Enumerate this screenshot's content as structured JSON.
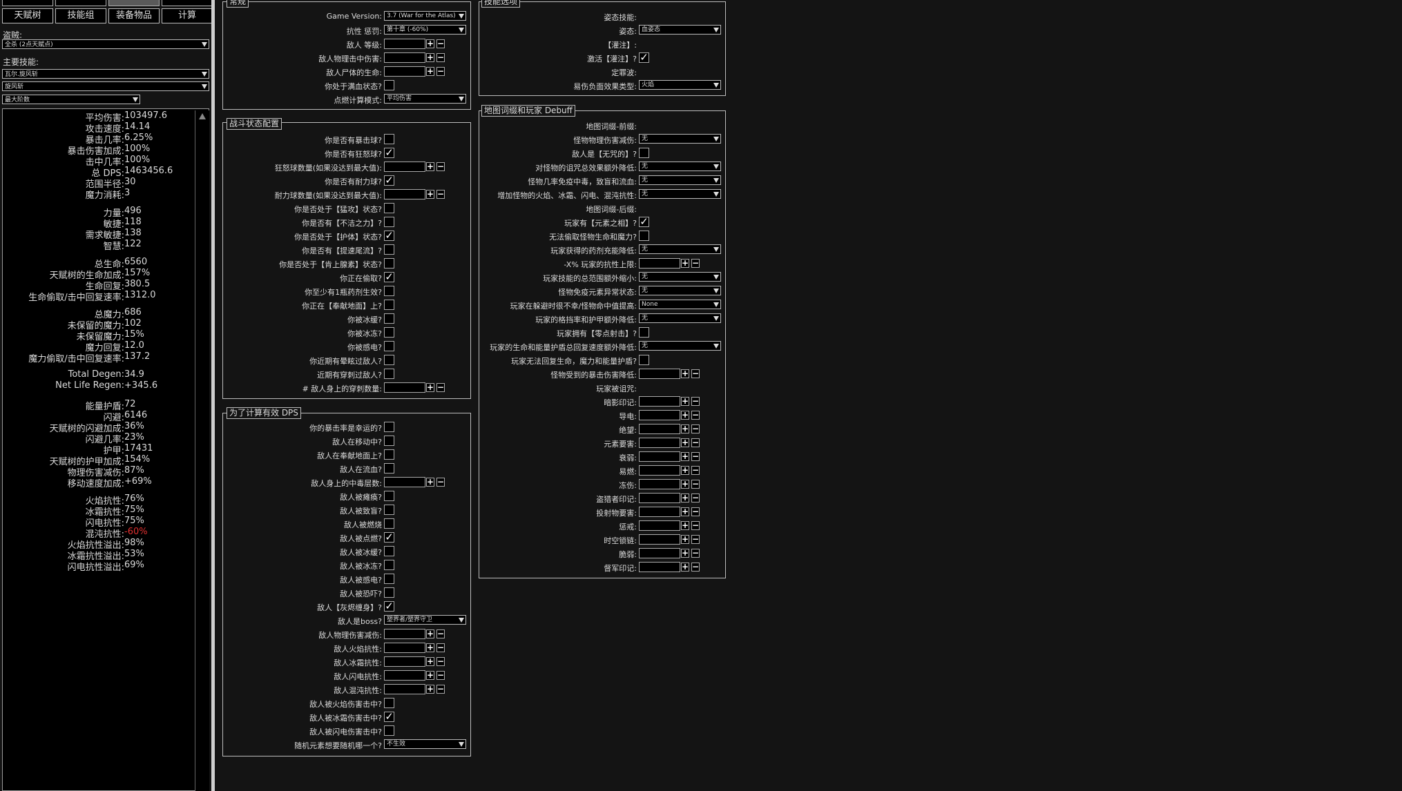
{
  "colors": {
    "background": "#141414",
    "negative": "#e03030",
    "border": "#bdbdbd"
  },
  "nav": {
    "tab_talent": "天赋树",
    "tab_gems": "技能组",
    "tab_items": "装备物品",
    "tab_calc": "计算"
  },
  "left": {
    "bandit_label": "盗贼:",
    "bandit_value": "全杀 (2点天赋点)",
    "main_skill_label": "主要技能:",
    "main_skill_value": "瓦尔.旋风斩",
    "sub_skill_value": "旋风斩",
    "stage_value": "最大阶数"
  },
  "stats": {
    "s1": [
      [
        "平均伤害:",
        "103497.6"
      ],
      [
        "攻击速度:",
        "14.14"
      ],
      [
        "暴击几率:",
        "6.25%"
      ],
      [
        "暴击伤害加成:",
        "100%"
      ],
      [
        "击中几率:",
        "100%"
      ],
      [
        "总 DPS:",
        "1463456.6"
      ],
      [
        "范围半径:",
        "30"
      ],
      [
        "魔力消耗:",
        "3"
      ]
    ],
    "s2": [
      [
        "力量:",
        "496"
      ],
      [
        "敏捷:",
        "118"
      ],
      [
        "需求敏捷:",
        "138"
      ],
      [
        "智慧:",
        "122"
      ]
    ],
    "s3": [
      [
        "总生命:",
        "6560"
      ],
      [
        "天赋树的生命加成:",
        "157%"
      ],
      [
        "生命回复:",
        "380.5"
      ],
      [
        "生命偷取/击中回复速率:",
        "1312.0"
      ]
    ],
    "s4": [
      [
        "总魔力:",
        "686"
      ],
      [
        "未保留的魔力:",
        "102"
      ],
      [
        "未保留魔力:",
        "15%"
      ],
      [
        "魔力回复:",
        "12.0"
      ],
      [
        "魔力偷取/击中回复速率:",
        "137.2"
      ]
    ],
    "s5": [
      [
        "Total Degen:",
        "34.9"
      ],
      [
        "Net Life Regen:",
        "+345.6"
      ]
    ],
    "s6": [
      [
        "能量护盾:",
        "72"
      ],
      [
        "闪避:",
        "6146"
      ],
      [
        "天赋树的闪避加成:",
        "36%"
      ],
      [
        "闪避几率:",
        "23%"
      ],
      [
        "护甲:",
        "17431"
      ],
      [
        "天赋树的护甲加成:",
        "154%"
      ],
      [
        "物理伤害减伤:",
        "87%"
      ],
      [
        "移动速度加成:",
        "+69%"
      ]
    ],
    "s7": [
      [
        "火焰抗性:",
        "76%"
      ],
      [
        "冰霜抗性:",
        "75%"
      ],
      [
        "闪电抗性:",
        "75%"
      ],
      [
        "混沌抗性:",
        "-60%"
      ],
      [
        "火焰抗性溢出:",
        "98%"
      ],
      [
        "冰霜抗性溢出:",
        "53%"
      ],
      [
        "闪电抗性溢出:",
        "69%"
      ]
    ]
  },
  "general": {
    "title": "常规",
    "game_version_label": "Game Version:",
    "game_version_value": "3.7 (War for the Atlas)",
    "res_penalty_label": "抗性 惩罚:",
    "res_penalty_value": "第十章 (-60%)",
    "enemy_level_label": "敌人 等级:",
    "enemy_phys_label": "敌人物理击中伤害:",
    "corpse_life_label": "敌人尸体的生命:",
    "full_life_label": "你处于满血状态?",
    "ignite_mode_label": "点燃计算模式:",
    "ignite_mode_value": "平均伤害"
  },
  "combat": {
    "title": "战斗状态配置",
    "rows": [
      {
        "label": "你是否有暴击球?",
        "type": "cb",
        "checked": false
      },
      {
        "label": "你是否有狂怒球?",
        "type": "cb",
        "checked": true
      },
      {
        "label": "狂怒球数量(如果没达到最大值):",
        "type": "num"
      },
      {
        "label": "你是否有耐力球?",
        "type": "cb",
        "checked": true
      },
      {
        "label": "耐力球数量(如果没达到最大值):",
        "type": "num"
      },
      {
        "label": "你是否处于【猛攻】状态?",
        "type": "cb",
        "checked": false
      },
      {
        "label": "你是否有【不洁之力】?",
        "type": "cb",
        "checked": false
      },
      {
        "label": "你是否处于【护体】状态?",
        "type": "cb",
        "checked": true
      },
      {
        "label": "你是否有【提速尾流】?",
        "type": "cb",
        "checked": false
      },
      {
        "label": "你是否处于【肯上腺素】状态?",
        "type": "cb",
        "checked": false
      },
      {
        "label": "你正在偷取?",
        "type": "cb",
        "checked": true
      },
      {
        "label": "你至少有1瓶药剂生效?",
        "type": "cb",
        "checked": false
      },
      {
        "label": "你正在【奉献地面】上?",
        "type": "cb",
        "checked": false
      },
      {
        "label": "你被冰缓?",
        "type": "cb",
        "checked": false
      },
      {
        "label": "你被冰冻?",
        "type": "cb",
        "checked": false
      },
      {
        "label": "你被感电?",
        "type": "cb",
        "checked": false
      },
      {
        "label": "你近期有晕眩过敌人?",
        "type": "cb",
        "checked": false
      },
      {
        "label": "近期有穿刺过敌人?",
        "type": "cb",
        "checked": false
      },
      {
        "label": "# 敌人身上的穿刺数量:",
        "type": "num"
      }
    ]
  },
  "effective": {
    "title": "为了计算有效 DPS",
    "rows": [
      {
        "label": "你的暴击率是幸运的?",
        "type": "cb",
        "checked": false
      },
      {
        "label": "敌人在移动中?",
        "type": "cb",
        "checked": false
      },
      {
        "label": "敌人在奉献地面上?",
        "type": "cb",
        "checked": false
      },
      {
        "label": "敌人在流血?",
        "type": "cb",
        "checked": false
      },
      {
        "label": "敌人身上的中毒层数:",
        "type": "num"
      },
      {
        "label": "敌人被瘫痪?",
        "type": "cb",
        "checked": false
      },
      {
        "label": "敌人被致盲?",
        "type": "cb",
        "checked": false
      },
      {
        "label": "敌人被燃烧",
        "type": "cb",
        "checked": false
      },
      {
        "label": "敌人被点燃?",
        "type": "cb",
        "checked": true
      },
      {
        "label": "敌人被冰缓?",
        "type": "cb",
        "checked": false
      },
      {
        "label": "敌人被冰冻?",
        "type": "cb",
        "checked": false
      },
      {
        "label": "敌人被感电?",
        "type": "cb",
        "checked": false
      },
      {
        "label": "敌人被恐吓?",
        "type": "cb",
        "checked": false
      },
      {
        "label": "敌人【灰烬缠身】?",
        "type": "cb",
        "checked": true
      },
      {
        "label": "敌人是boss?",
        "type": "dd",
        "value": "塑界者/塑界守卫"
      },
      {
        "label": "敌人物理伤害减伤:",
        "type": "num"
      },
      {
        "label": "敌人火焰抗性:",
        "type": "num"
      },
      {
        "label": "敌人冰霜抗性:",
        "type": "num"
      },
      {
        "label": "敌人闪电抗性:",
        "type": "num"
      },
      {
        "label": "敌人混沌抗性:",
        "type": "num"
      },
      {
        "label": "敌人被火焰伤害击中?",
        "type": "cb",
        "checked": false
      },
      {
        "label": "敌人被冰霜伤害击中?",
        "type": "cb",
        "checked": true
      },
      {
        "label": "敌人被闪电伤害击中?",
        "type": "cb",
        "checked": false
      },
      {
        "label": "随机元素想要随机哪一个?",
        "type": "dd",
        "value": "不生效"
      }
    ]
  },
  "skill_options": {
    "title": "技能选项",
    "rows": [
      {
        "label": "姿态技能:",
        "type": "text"
      },
      {
        "label": "姿态:",
        "type": "dd",
        "value": "血姿态"
      },
      {
        "label": "【灌注】:",
        "type": "text"
      },
      {
        "label": "激活【灌注】?",
        "type": "cb",
        "checked": true
      },
      {
        "label": "定罪波:",
        "type": "text"
      },
      {
        "label": "易伤负面效果类型:",
        "type": "dd",
        "value": "火焰"
      }
    ]
  },
  "map_mods": {
    "title": "地图词缀和玩家 Debuff",
    "rows": [
      {
        "label": "地图词缀-前缀:",
        "type": "text"
      },
      {
        "label": "怪物物理伤害减伤:",
        "type": "dd",
        "value": "无"
      },
      {
        "label": "敌人是【无咒的】?",
        "type": "cb",
        "checked": false
      },
      {
        "label": "对怪物的诅咒总效果额外降低:",
        "type": "dd",
        "value": "无"
      },
      {
        "label": "怪物几率免疫中毒，致盲和流血:",
        "type": "dd",
        "value": "无"
      },
      {
        "label": "增加怪物的火焰、冰霜、闪电、混沌抗性:",
        "type": "dd",
        "value": "无"
      },
      {
        "label": "地图词缀-后缀:",
        "type": "text"
      },
      {
        "label": "玩家有【元素之相】?",
        "type": "cb",
        "checked": true
      },
      {
        "label": "无法偷取怪物生命和魔力?",
        "type": "cb",
        "checked": false
      },
      {
        "label": "玩家获得的药剂充能降低:",
        "type": "dd",
        "value": "无"
      },
      {
        "label": "-X% 玩家的抗性上限:",
        "type": "num"
      },
      {
        "label": "玩家技能的总范围额外缩小:",
        "type": "dd",
        "value": "无"
      },
      {
        "label": "怪物免疫元素异常状态:",
        "type": "dd",
        "value": "无"
      },
      {
        "label": "玩家在躲避时很不幸/怪物命中值提高:",
        "type": "dd",
        "value": "None"
      },
      {
        "label": "玩家的格挡率和护甲额外降低:",
        "type": "dd",
        "value": "无"
      },
      {
        "label": "玩家拥有【零点射击】?",
        "type": "cb",
        "checked": false
      },
      {
        "label": "玩家的生命和能量护盾总回复速度额外降低:",
        "type": "dd",
        "value": "无"
      },
      {
        "label": "玩家无法回复生命，魔力和能量护盾?",
        "type": "cb",
        "checked": false
      },
      {
        "label": "怪物受到的暴击伤害降低:",
        "type": "num"
      },
      {
        "label": "玩家被诅咒:",
        "type": "text"
      },
      {
        "label": "暗影印记:",
        "type": "num"
      },
      {
        "label": "导电:",
        "type": "num"
      },
      {
        "label": "绝望:",
        "type": "num"
      },
      {
        "label": "元素要害:",
        "type": "num"
      },
      {
        "label": "衰弱:",
        "type": "num"
      },
      {
        "label": "易燃:",
        "type": "num"
      },
      {
        "label": "冻伤:",
        "type": "num"
      },
      {
        "label": "盗猎者印记:",
        "type": "num"
      },
      {
        "label": "投射物要害:",
        "type": "num"
      },
      {
        "label": "惩戒:",
        "type": "num"
      },
      {
        "label": "时空锁链:",
        "type": "num"
      },
      {
        "label": "脆弱:",
        "type": "num"
      },
      {
        "label": "督军印记:",
        "type": "num"
      }
    ]
  }
}
